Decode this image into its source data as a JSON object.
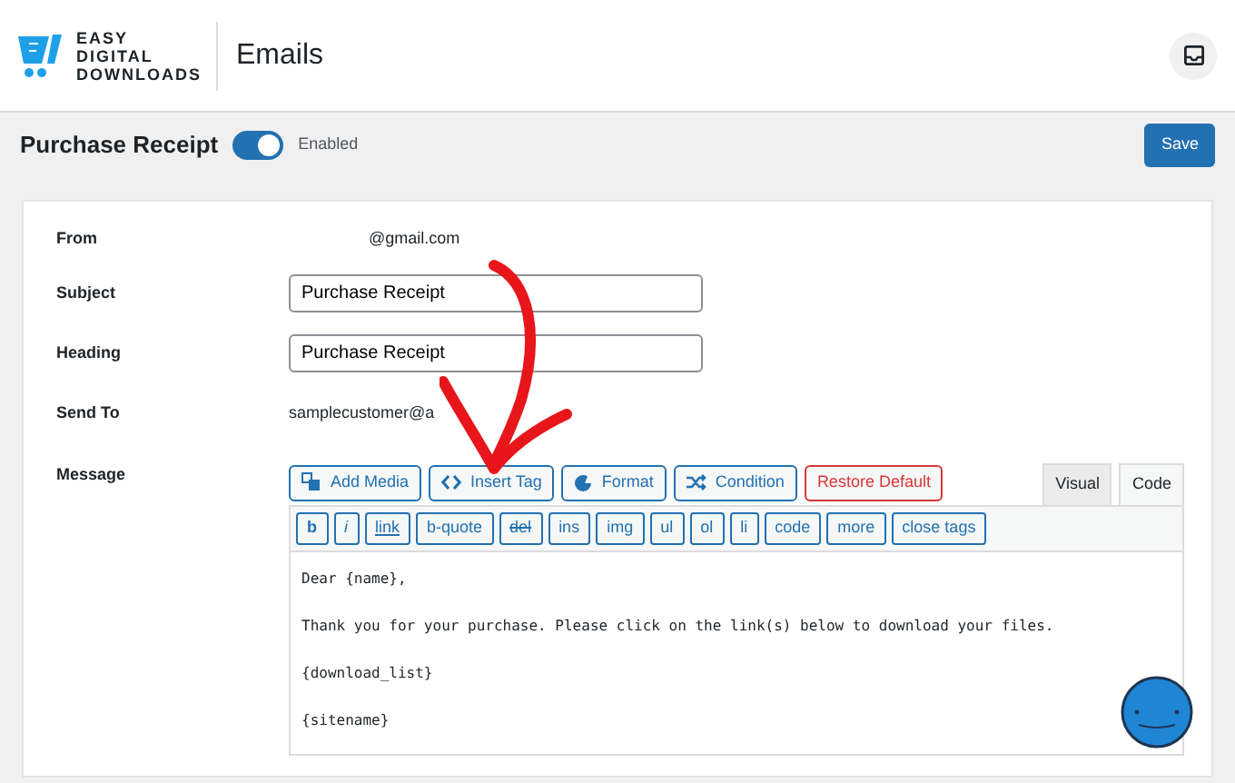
{
  "header": {
    "brand": [
      "EASY",
      "DIGITAL",
      "DOWNLOADS"
    ],
    "title": "Emails"
  },
  "email_bar": {
    "title": "Purchase Receipt",
    "toggle": {
      "on": true,
      "label": "Enabled"
    },
    "save": "Save"
  },
  "fields": [
    {
      "kind": "text",
      "label": "From",
      "value": "@gmail.com"
    },
    {
      "kind": "input",
      "label": "Subject",
      "value": "Purchase Receipt"
    },
    {
      "kind": "input",
      "label": "Heading",
      "value": "Purchase Receipt"
    },
    {
      "kind": "text",
      "label": "Send To",
      "value": "samplecustomer@a"
    }
  ],
  "message": {
    "label": "Message",
    "buttons": [
      {
        "kind": "media",
        "label": "Add Media"
      },
      {
        "kind": "tag",
        "label": "Insert Tag"
      },
      {
        "kind": "format",
        "label": "Format"
      },
      {
        "kind": "condition",
        "label": "Condition"
      },
      {
        "kind": "danger",
        "label": "Restore Default"
      }
    ],
    "tabs": [
      {
        "label": "Visual",
        "selected": false
      },
      {
        "label": "Code",
        "selected": true
      }
    ],
    "quicktags": [
      {
        "kind": "bold",
        "label": "b"
      },
      {
        "kind": "italic",
        "label": "i"
      },
      {
        "kind": "underline",
        "label": "link"
      },
      {
        "kind": "plain",
        "label": "b-quote"
      },
      {
        "kind": "strike",
        "label": "del"
      },
      {
        "kind": "plain",
        "label": "ins"
      },
      {
        "kind": "plain",
        "label": "img"
      },
      {
        "kind": "plain",
        "label": "ul"
      },
      {
        "kind": "plain",
        "label": "ol"
      },
      {
        "kind": "plain",
        "label": "li"
      },
      {
        "kind": "plain",
        "label": "code"
      },
      {
        "kind": "plain",
        "label": "more"
      },
      {
        "kind": "plain",
        "label": "close tags"
      }
    ],
    "body": [
      "Dear {name},",
      "Thank you for your purchase. Please click on the link(s) below to download your files.",
      "{download_list}",
      "{sitename}"
    ]
  }
}
